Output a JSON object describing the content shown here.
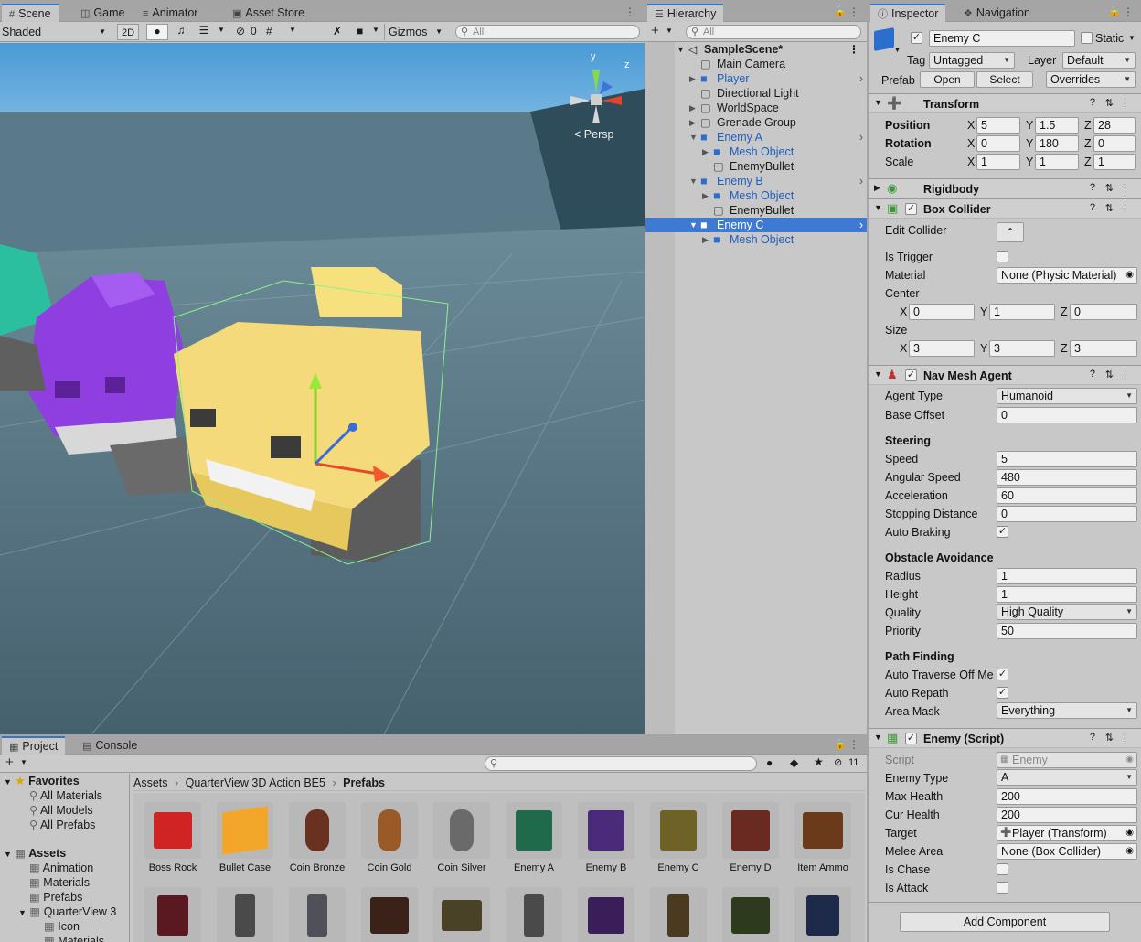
{
  "scene_panel": {
    "tabs": [
      "Scene",
      "Game",
      "Animator",
      "Asset Store"
    ],
    "shading_mode": "Shaded",
    "mode_2d_label": "2D",
    "hidden_count": "0",
    "gizmos_label": "Gizmos",
    "search_placeholder": "All",
    "view_label": "Persp",
    "axis_y": "y",
    "axis_z": "z"
  },
  "hierarchy": {
    "title": "Hierarchy",
    "search_placeholder": "All",
    "scene_name": "SampleScene*",
    "items": [
      {
        "label": "Main Camera",
        "prefab": false
      },
      {
        "label": "Player",
        "prefab": true
      },
      {
        "label": "Directional Light",
        "prefab": false
      },
      {
        "label": "WorldSpace",
        "prefab": false
      },
      {
        "label": "Grenade Group",
        "prefab": false
      },
      {
        "label": "Enemy A",
        "prefab": true
      },
      {
        "label": "Mesh Object",
        "prefab": true
      },
      {
        "label": "EnemyBullet",
        "prefab": false
      },
      {
        "label": "Enemy B",
        "prefab": true
      },
      {
        "label": "Mesh Object",
        "prefab": true
      },
      {
        "label": "EnemyBullet",
        "prefab": false
      },
      {
        "label": "Enemy C",
        "prefab": true
      },
      {
        "label": "Mesh Object",
        "prefab": true
      }
    ]
  },
  "inspector": {
    "tabs": [
      "Inspector",
      "Navigation"
    ],
    "object_name": "Enemy C",
    "static_label": "Static",
    "tag_label": "Tag",
    "tag_value": "Untagged",
    "layer_label": "Layer",
    "layer_value": "Default",
    "prefab_label": "Prefab",
    "prefab_open": "Open",
    "prefab_select": "Select",
    "prefab_overrides": "Overrides",
    "transform": {
      "title": "Transform",
      "position_label": "Position",
      "position": [
        "5",
        "1.5",
        "28"
      ],
      "rotation_label": "Rotation",
      "rotation": [
        "0",
        "180",
        "0"
      ],
      "scale_label": "Scale",
      "scale": [
        "1",
        "1",
        "1"
      ]
    },
    "rigidbody": {
      "title": "Rigidbody"
    },
    "box_collider": {
      "title": "Box Collider",
      "edit_collider": "Edit Collider",
      "is_trigger": "Is Trigger",
      "material_label": "Material",
      "material_value": "None (Physic Material)",
      "center_label": "Center",
      "center": [
        "0",
        "1",
        "0"
      ],
      "size_label": "Size",
      "size": [
        "3",
        "3",
        "3"
      ]
    },
    "nav_mesh_agent": {
      "title": "Nav Mesh Agent",
      "agent_type_label": "Agent Type",
      "agent_type": "Humanoid",
      "base_offset_label": "Base Offset",
      "base_offset": "0",
      "steering_header": "Steering",
      "speed_label": "Speed",
      "speed": "5",
      "angular_speed_label": "Angular Speed",
      "angular_speed": "480",
      "acceleration_label": "Acceleration",
      "acceleration": "60",
      "stopping_distance_label": "Stopping Distance",
      "stopping_distance": "0",
      "auto_braking_label": "Auto Braking",
      "obstacle_header": "Obstacle Avoidance",
      "radius_label": "Radius",
      "radius": "1",
      "height_label": "Height",
      "height": "1",
      "quality_label": "Quality",
      "quality": "High Quality",
      "priority_label": "Priority",
      "priority": "50",
      "path_header": "Path Finding",
      "auto_traverse_label": "Auto Traverse Off Me",
      "auto_repath_label": "Auto Repath",
      "area_mask_label": "Area Mask",
      "area_mask": "Everything"
    },
    "enemy_script": {
      "title": "Enemy (Script)",
      "script_label": "Script",
      "script_value": "Enemy",
      "enemy_type_label": "Enemy Type",
      "enemy_type": "A",
      "max_health_label": "Max Health",
      "max_health": "200",
      "cur_health_label": "Cur Health",
      "cur_health": "200",
      "target_label": "Target",
      "target": "Player (Transform)",
      "melee_label": "Melee Area",
      "melee": "None (Box Collider)",
      "is_chase_label": "Is Chase",
      "is_attack_label": "Is Attack"
    },
    "add_component": "Add Component"
  },
  "project": {
    "tabs": [
      "Project",
      "Console"
    ],
    "hidden_count": "11",
    "favorites": "Favorites",
    "favorite_items": [
      "All Materials",
      "All Models",
      "All Prefabs"
    ],
    "assets_label": "Assets",
    "asset_folders": [
      "Animation",
      "Materials",
      "Prefabs",
      "QuarterView 3",
      "Icon",
      "Materials"
    ],
    "breadcrumb": [
      "Assets",
      "QuarterView 3D Action BE5",
      "Prefabs"
    ],
    "assets_row1": [
      "Boss Rock",
      "Bullet Case",
      "Coin Bronze",
      "Coin Gold",
      "Coin Silver",
      "Enemy A",
      "Enemy B",
      "Enemy C",
      "Enemy D",
      "Item Ammo"
    ]
  },
  "colors": {
    "accent": "#3a72c4",
    "selection": "#3e7ad1",
    "prefab_text": "#1f5fbf",
    "panel": "#c8c8c8"
  }
}
